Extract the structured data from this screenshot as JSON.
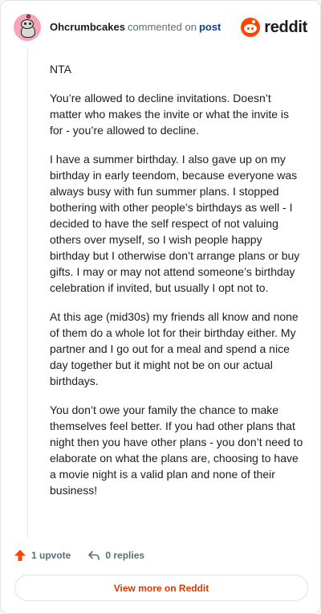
{
  "header": {
    "username": "Ohcrumbcakes",
    "commented": "commented on",
    "post_link": "post",
    "logo_text": "reddit"
  },
  "comment": {
    "paragraphs": [
      "NTA",
      "You’re allowed to decline invitations. Doesn’t matter who makes the invite or what the invite is for - you’re allowed to decline.",
      "I have a summer birthday. I also gave up on my birthday in early teendom, because everyone was always busy with fun summer plans. I stopped bothering with other people’s birthdays as well - I decided to have the self respect of not valuing others over myself, so I wish people happy birthday but I otherwise don’t arrange plans or buy gifts. I may or may not attend someone’s birthday celebration if invited, but usually I opt not to.",
      "At this age (mid30s) my friends all know and none of them do a whole lot for their birthday either. My partner and I go out for a meal and spend a nice day together but it might not be on our actual birthdays.",
      "You don’t owe your family the chance to make themselves feel better. If you had other plans that night then you have other plans - you don’t need to elaborate on what the plans are, choosing to have a movie night is a valid plan and none of their business!"
    ]
  },
  "actions": {
    "upvote_label": "1 upvote",
    "replies_label": "0 replies"
  },
  "footer": {
    "view_more_label": "View more on Reddit"
  },
  "colors": {
    "brand": "#ff4500",
    "link": "#0a449b",
    "view_more": "#d93900",
    "muted": "#576f76"
  },
  "icons": {
    "avatar": "snoo-avatar-icon",
    "logo": "reddit-logo-icon",
    "upvote": "upvote-arrow-icon",
    "reply": "reply-arrow-icon"
  }
}
